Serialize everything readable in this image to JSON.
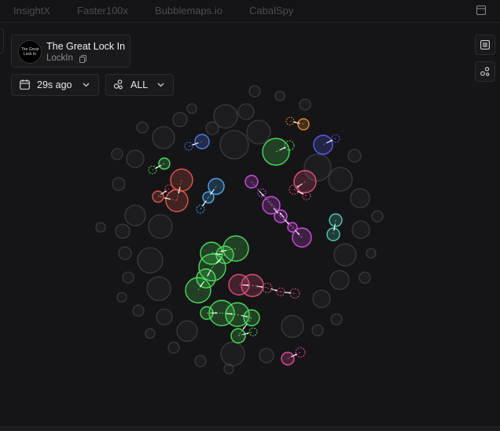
{
  "tabs": [
    {
      "label": "InsightX",
      "active": true
    },
    {
      "label": "Faster100x",
      "active": false
    },
    {
      "label": "Bubblemaps.io",
      "active": false
    },
    {
      "label": "CabalSpy",
      "active": false
    }
  ],
  "token": {
    "avatar_text": "The Great Lock In",
    "name": "The Great Lock In",
    "symbol": "LockIn"
  },
  "time_filter": {
    "value": "29s ago"
  },
  "wallet_filter": {
    "value": "ALL"
  },
  "icons": {
    "window": "window-icon",
    "copy": "copy-icon",
    "calendar": "calendar-icon",
    "chevron": "chevron-down-icon",
    "cluster": "cluster-icon",
    "list": "list-icon",
    "share": "share-icon"
  },
  "colors": {
    "background": "#151517",
    "neutral_bubble": "#3a3a40",
    "green": "#4ddc5a",
    "red": "#e0584c",
    "blue": "#4f7ff0",
    "light_blue": "#4fa8ee",
    "purple": "#cc4fe0",
    "pink": "#e0507c",
    "violet": "#5a5af0",
    "teal": "#4fc8b8",
    "orange": "#e08a2c",
    "magenta": "#e04ca0"
  },
  "bubble_map": {
    "neutral": [
      [
        287,
        148,
        15
      ],
      [
        313,
        142,
        10
      ],
      [
        329,
        168,
        15
      ],
      [
        298,
        184,
        18
      ],
      [
        270,
        163,
        8
      ],
      [
        244,
        138,
        6
      ],
      [
        229,
        152,
        9
      ],
      [
        208,
        175,
        14
      ],
      [
        181,
        162,
        7
      ],
      [
        172,
        202,
        11
      ],
      [
        149,
        196,
        7
      ],
      [
        151,
        234,
        8
      ],
      [
        172,
        274,
        13
      ],
      [
        204,
        288,
        15
      ],
      [
        156,
        294,
        9
      ],
      [
        128,
        289,
        6
      ],
      [
        159,
        322,
        8
      ],
      [
        191,
        331,
        16
      ],
      [
        163,
        353,
        7
      ],
      [
        155,
        378,
        6
      ],
      [
        202,
        367,
        15
      ],
      [
        176,
        395,
        7
      ],
      [
        209,
        403,
        10
      ],
      [
        238,
        421,
        13
      ],
      [
        191,
        424,
        6
      ],
      [
        221,
        442,
        7
      ],
      [
        255,
        459,
        7
      ],
      [
        296,
        450,
        15
      ],
      [
        291,
        469,
        6
      ],
      [
        339,
        452,
        9
      ],
      [
        324,
        116,
        7
      ],
      [
        356,
        122,
        6
      ],
      [
        388,
        133,
        7
      ],
      [
        404,
        213,
        17
      ],
      [
        433,
        228,
        15
      ],
      [
        451,
        198,
        8
      ],
      [
        458,
        252,
        12
      ],
      [
        480,
        275,
        7
      ],
      [
        459,
        292,
        11
      ],
      [
        439,
        324,
        14
      ],
      [
        472,
        322,
        6
      ],
      [
        432,
        356,
        12
      ],
      [
        464,
        353,
        7
      ],
      [
        409,
        380,
        11
      ],
      [
        428,
        406,
        7
      ],
      [
        372,
        415,
        14
      ],
      [
        404,
        420,
        7
      ]
    ],
    "colored": [
      {
        "c": "green",
        "b": [
          [
            351,
            193,
            17
          ]
        ],
        "dash": [
          [
            368,
            185,
            6
          ]
        ]
      },
      {
        "c": "green",
        "b": [
          [
            209,
            208,
            7
          ]
        ],
        "dash": [
          [
            194,
            216,
            5
          ]
        ]
      },
      {
        "c": "red",
        "b": [
          [
            231,
            229,
            14
          ],
          [
            225,
            255,
            14
          ],
          [
            201,
            250,
            7
          ]
        ],
        "dash": [
          [
            215,
            240,
            5
          ]
        ]
      },
      {
        "c": "blue",
        "b": [
          [
            257,
            180,
            9
          ]
        ],
        "dash": [
          [
            240,
            186,
            5
          ]
        ]
      },
      {
        "c": "light_blue",
        "b": [
          [
            275,
            237,
            10
          ],
          [
            265,
            251,
            7
          ]
        ],
        "dash": [
          [
            255,
            266,
            5
          ]
        ]
      },
      {
        "c": "violet",
        "b": [
          [
            411,
            184,
            12
          ]
        ],
        "dash": [
          [
            427,
            176,
            5
          ]
        ]
      },
      {
        "c": "orange",
        "b": [
          [
            386,
            158,
            7
          ]
        ],
        "dash": [
          [
            369,
            154,
            5
          ]
        ]
      },
      {
        "c": "purple",
        "b": [
          [
            320,
            231,
            8
          ],
          [
            345,
            261,
            11
          ],
          [
            357,
            275,
            8
          ],
          [
            372,
            289,
            6
          ],
          [
            384,
            302,
            12
          ]
        ],
        "dash": [
          [
            333,
            245,
            5
          ]
        ]
      },
      {
        "c": "pink",
        "b": [
          [
            388,
            231,
            14
          ]
        ],
        "dash": [
          [
            374,
            241,
            6
          ],
          [
            390,
            249,
            5
          ]
        ]
      },
      {
        "c": "teal",
        "b": [
          [
            427,
            280,
            8
          ],
          [
            424,
            298,
            8
          ]
        ],
        "dash": []
      },
      {
        "c": "green",
        "b": [
          [
            300,
            316,
            16
          ],
          [
            269,
            322,
            14
          ],
          [
            286,
            324,
            11
          ],
          [
            270,
            340,
            17
          ],
          [
            262,
            354,
            12
          ],
          [
            252,
            369,
            16
          ]
        ],
        "dash": []
      },
      {
        "c": "pink",
        "b": [
          [
            304,
            362,
            13
          ],
          [
            321,
            363,
            14
          ]
        ],
        "dash": [
          [
            340,
            366,
            6
          ],
          [
            357,
            371,
            5
          ],
          [
            375,
            373,
            6
          ]
        ]
      },
      {
        "c": "green",
        "b": [
          [
            263,
            398,
            8
          ],
          [
            282,
            398,
            16
          ],
          [
            302,
            400,
            15
          ],
          [
            320,
            404,
            10
          ],
          [
            303,
            427,
            9
          ]
        ],
        "dash": [
          [
            322,
            422,
            5
          ]
        ]
      },
      {
        "c": "magenta",
        "b": [
          [
            366,
            456,
            8
          ]
        ],
        "dash": [
          [
            382,
            448,
            6
          ]
        ]
      }
    ]
  }
}
